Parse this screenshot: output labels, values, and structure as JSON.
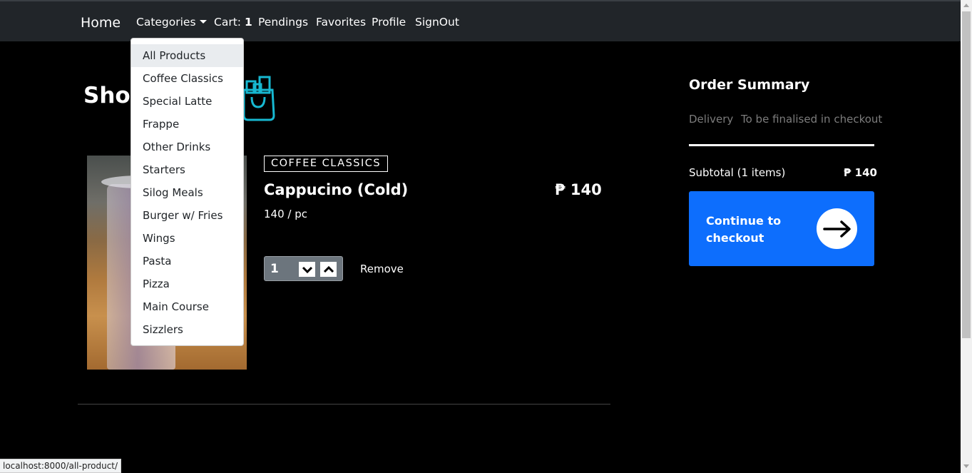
{
  "nav": {
    "brand": "Home",
    "categories": "Categories",
    "cart_label": "Cart:",
    "cart_count": "1",
    "pendings": "Pendings",
    "favorites": "Favorites",
    "profile": "Profile",
    "signout": "SignOut"
  },
  "dropdown": {
    "items": [
      {
        "label": "All Products"
      },
      {
        "label": "Coffee Classics"
      },
      {
        "label": "Special Latte"
      },
      {
        "label": "Frappe"
      },
      {
        "label": "Other Drinks"
      },
      {
        "label": "Starters"
      },
      {
        "label": "Silog Meals"
      },
      {
        "label": "Burger w/ Fries"
      },
      {
        "label": "Wings"
      },
      {
        "label": "Pasta"
      },
      {
        "label": "Pizza"
      },
      {
        "label": "Main Course"
      },
      {
        "label": "Sizzlers"
      }
    ]
  },
  "page": {
    "title": "Shop"
  },
  "cart_item": {
    "category": "COFFEE CLASSICS",
    "name": "Cappucino (Cold)",
    "price": "₱ 140",
    "unit": "140 / pc",
    "quantity": "1",
    "remove": "Remove"
  },
  "summary": {
    "title": "Order Summary",
    "delivery_label": "Delivery",
    "delivery_value": "To be finalised in checkout",
    "subtotal_label": "Subtotal (1 items)",
    "subtotal_value": "₱ 140",
    "checkout_label": "Continue to checkout"
  },
  "status_bar": {
    "url": "localhost:8000/all-product/"
  },
  "colors": {
    "navbar": "#212529",
    "background": "#000000",
    "accent": "#0d6efd",
    "bag_icon": "#17b8d1",
    "qty_box": "#6c757d"
  },
  "icons": {
    "bag": "shopping-bag-icon",
    "caret": "caret-down-icon",
    "qty_down": "chevron-down-icon",
    "qty_up": "chevron-up-icon",
    "checkout": "arrow-right-icon"
  }
}
